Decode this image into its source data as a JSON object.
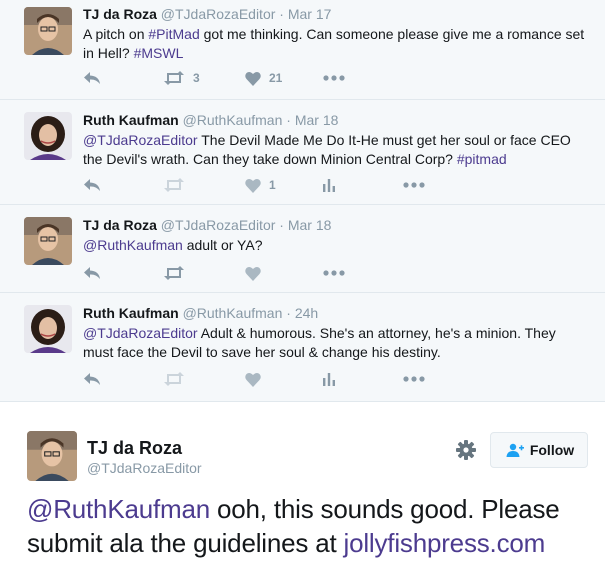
{
  "colors": {
    "link": "#4c3b8f",
    "muted": "#8899a6",
    "icon": "#aab8c2",
    "thread_bg": "#f5f8fa"
  },
  "tweets": [
    {
      "fullname": "TJ da Roza",
      "handle": "@TJdaRozaEditor",
      "date": "Mar 17",
      "text_segments": [
        {
          "text": "A pitch on ",
          "link": false
        },
        {
          "text": "#PitMad",
          "link": true
        },
        {
          "text": " got me thinking. Can someone please give me a romance set in Hell? ",
          "link": false
        },
        {
          "text": "#MSWL",
          "link": true
        }
      ],
      "retweets": "3",
      "likes": "21"
    },
    {
      "fullname": "Ruth Kaufman",
      "handle": "@RuthKaufman",
      "date": "Mar 18",
      "text_segments": [
        {
          "text": "@TJdaRozaEditor",
          "link": true
        },
        {
          "text": " The Devil Made Me Do It-He must get her soul or face CEO the Devil's wrath. Can they take down Minion Central Corp? ",
          "link": false
        },
        {
          "text": "#pitmad",
          "link": true
        }
      ],
      "retweets": "",
      "likes": "1"
    },
    {
      "fullname": "TJ da Roza",
      "handle": "@TJdaRozaEditor",
      "date": "Mar 18",
      "text_segments": [
        {
          "text": "@RuthKaufman",
          "link": true
        },
        {
          "text": " adult or YA?",
          "link": false
        }
      ],
      "retweets": "",
      "likes": ""
    },
    {
      "fullname": "Ruth Kaufman",
      "handle": "@RuthKaufman",
      "date": "24h",
      "text_segments": [
        {
          "text": "@TJdaRozaEditor",
          "link": true
        },
        {
          "text": " Adult & humorous. She's an attorney, he's a minion. They must face the Devil to save her soul & change his destiny.",
          "link": false
        }
      ],
      "retweets": "",
      "likes": ""
    }
  ],
  "main_tweet": {
    "fullname": "TJ da Roza",
    "handle": "@TJdaRozaEditor",
    "follow_label": "Follow",
    "text_segments": [
      {
        "text": "@RuthKaufman",
        "link": true
      },
      {
        "text": " ooh, this sounds good. Please submit ala the guidelines at ",
        "link": false
      },
      {
        "text": "jollyfishpress.com",
        "link": true
      }
    ]
  }
}
